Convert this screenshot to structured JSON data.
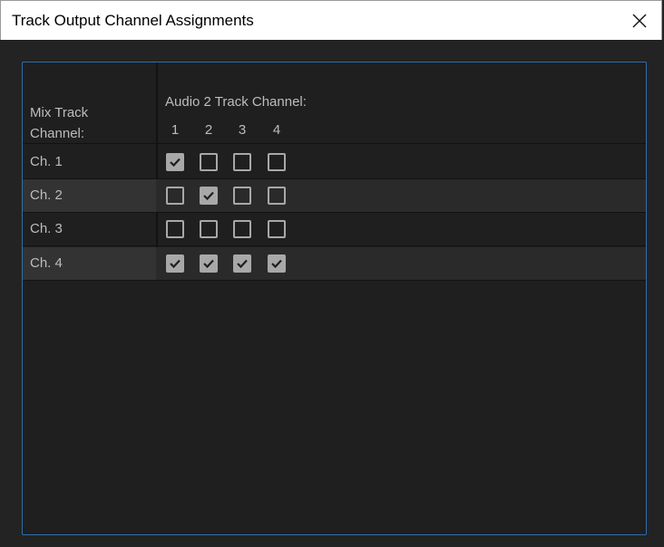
{
  "window": {
    "title": "Track Output Channel Assignments"
  },
  "header": {
    "mix_track_line1": "Mix Track",
    "mix_track_line2": "Channel:",
    "audio_track_label": "Audio 2 Track Channel:"
  },
  "columns": [
    "1",
    "2",
    "3",
    "4"
  ],
  "rows": [
    {
      "label": "Ch. 1",
      "checks": [
        true,
        false,
        false,
        false
      ]
    },
    {
      "label": "Ch. 2",
      "checks": [
        false,
        true,
        false,
        false
      ]
    },
    {
      "label": "Ch. 3",
      "checks": [
        false,
        false,
        false,
        false
      ]
    },
    {
      "label": "Ch. 4",
      "checks": [
        true,
        true,
        true,
        true
      ]
    }
  ],
  "colors": {
    "accent_border": "#2d6fae",
    "checkbox": "#a8a8a8"
  }
}
